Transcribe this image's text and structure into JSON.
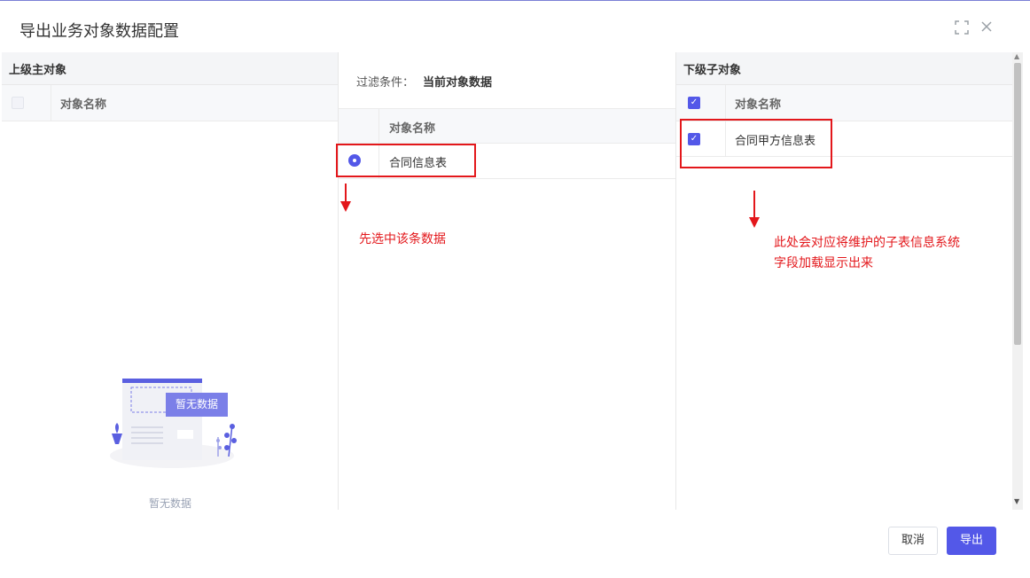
{
  "dialog": {
    "title": "导出业务对象数据配置",
    "fullscreen_icon": "expand-icon",
    "close_icon": "close-icon"
  },
  "left_panel": {
    "title": "上级主对象",
    "column_name": "对象名称",
    "empty_illustration_label": "暂无数据",
    "empty_text": "暂无数据"
  },
  "middle_panel": {
    "filter_label": "过滤条件：",
    "filter_value": "当前对象数据",
    "column_name": "对象名称",
    "rows": [
      {
        "name": "合同信息表",
        "selected": true
      }
    ]
  },
  "right_panel": {
    "title": "下级子对象",
    "column_name": "对象名称",
    "header_checked": true,
    "rows": [
      {
        "name": "合同甲方信息表",
        "checked": true
      }
    ]
  },
  "annotations": {
    "middle_note": "先选中该条数据",
    "right_note_line1": "此处会对应将维护的子表信息系统",
    "right_note_line2": "字段加载显示出来",
    "color": "#e3171b"
  },
  "footer": {
    "cancel_label": "取消",
    "export_label": "导出"
  },
  "colors": {
    "accent": "#5358e8"
  }
}
